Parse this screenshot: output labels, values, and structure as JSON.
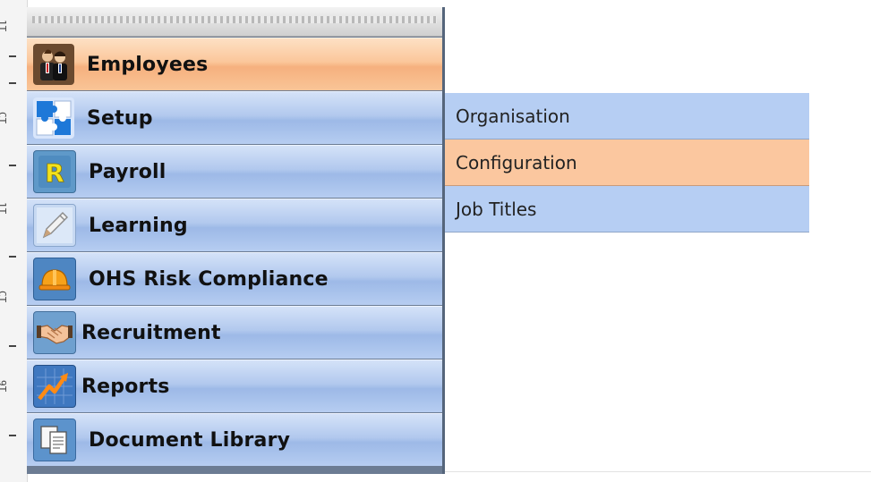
{
  "ruler": {
    "labels": [
      "1T",
      "CT",
      "1T",
      "CT",
      "9T"
    ]
  },
  "menu": {
    "items": [
      {
        "label": "Employees",
        "icon": "employees-icon"
      },
      {
        "label": "Setup",
        "icon": "setup-puzzle-icon"
      },
      {
        "label": "Payroll",
        "icon": "payroll-r-icon"
      },
      {
        "label": "Learning",
        "icon": "pencil-icon"
      },
      {
        "label": "OHS Risk Compliance",
        "icon": "hardhat-icon"
      },
      {
        "label": "Recruitment",
        "icon": "handshake-icon"
      },
      {
        "label": "Reports",
        "icon": "chart-arrow-icon"
      },
      {
        "label": "Document Library",
        "icon": "documents-icon"
      }
    ],
    "active_index": 0
  },
  "submenu": {
    "items": [
      {
        "label": "Organisation"
      },
      {
        "label": "Configuration"
      },
      {
        "label": "Job Titles"
      }
    ],
    "active_index": 1
  },
  "colors": {
    "active_orange": "#fbc79b",
    "menu_blue": "#b2c9ee",
    "submenu_blue": "#b6cef3"
  }
}
